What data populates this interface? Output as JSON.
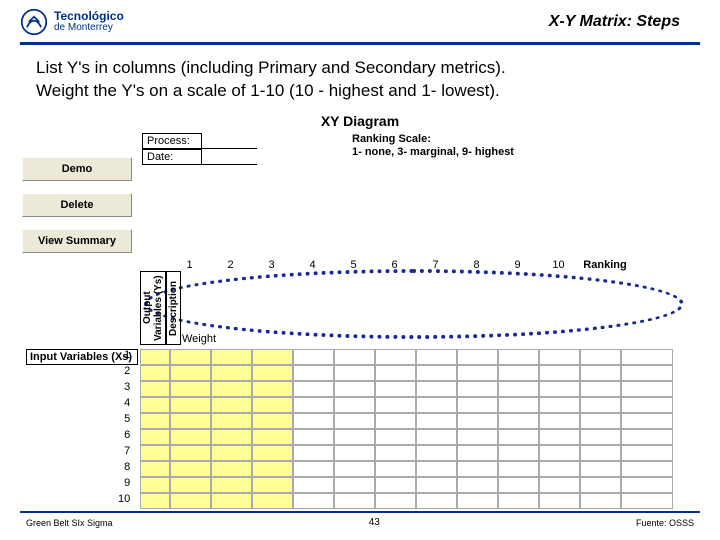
{
  "header": {
    "logo_top": "Tecnológico",
    "logo_bottom": "de Monterrey",
    "title": "X-Y Matrix: Steps"
  },
  "body": {
    "line1": "List Y's in columns (including Primary and Secondary metrics).",
    "line2": "Weight the Y's on a scale of 1-10 (10 - highest and 1- lowest)."
  },
  "diagram": {
    "title": "XY Diagram",
    "buttons": {
      "demo": "Demo",
      "delete": "Delete",
      "view": "View Summary"
    },
    "process_label": "Process:",
    "date_label": "Date:",
    "ranking_scale_title": "Ranking Scale:",
    "ranking_scale_line1": "1- none, 3- marginal, 9- highest",
    "vert1": "Output Variables (Ys)",
    "vert2": "Description",
    "weight_label": "Weight",
    "input_header": "Input Variables (Xs)",
    "ranking_header": "Ranking",
    "cols": [
      "1",
      "2",
      "3",
      "4",
      "5",
      "6",
      "7",
      "8",
      "9",
      "10"
    ],
    "rows": [
      "1",
      "2",
      "3",
      "4",
      "5",
      "6",
      "7",
      "8",
      "9",
      "10"
    ]
  },
  "footer": {
    "left": "Green Belt SIx Sigma",
    "center": "43",
    "right": "Fuente: OSSS"
  }
}
